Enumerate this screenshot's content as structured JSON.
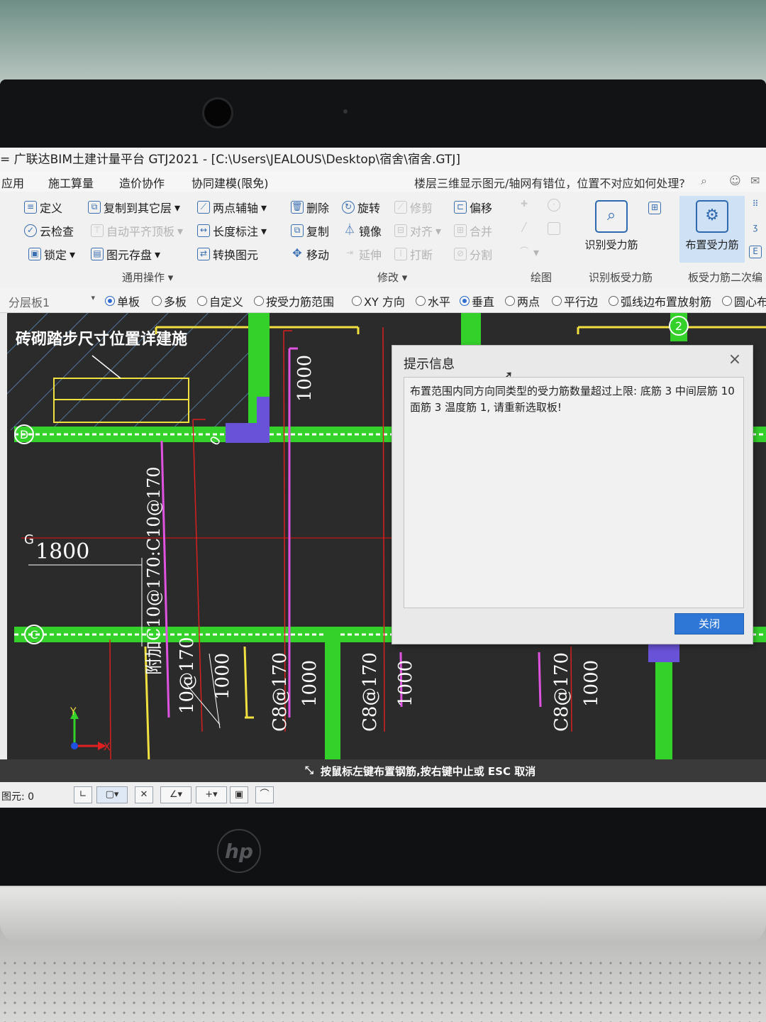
{
  "window": {
    "title": "= 广联达BIM土建计量平台 GTJ2021 - [C:\\Users\\JEALOUS\\Desktop\\宿舍\\宿舍.GTJ]"
  },
  "menu": {
    "items": [
      "应用",
      "施工算量",
      "造价协作",
      "协同建模(限免)"
    ],
    "question": "楼层三维显示图元/轴网有错位，位置不对应如何处理?"
  },
  "ribbon": {
    "general": [
      "定义",
      "复制到其它层",
      "两点辅轴",
      "云检查",
      "自动平齐顶板",
      "长度标注",
      "锁定",
      "图元存盘",
      "转换图元"
    ],
    "general_group": "通用操作",
    "modify": [
      "删除",
      "旋转",
      "修剪",
      "偏移",
      "复制",
      "镜像",
      "对齐",
      "合并",
      "移动",
      "延伸",
      "打断",
      "分割"
    ],
    "modify_group": "修改",
    "draw_group": "绘图",
    "identify_button": "识别受力筋",
    "identify_group": "识别板受力筋",
    "place_button": "布置受力筋",
    "place_group": "板受力筋二次编"
  },
  "options": {
    "layer": "分层板1",
    "radios": [
      {
        "label": "单板",
        "checked": true
      },
      {
        "label": "多板",
        "checked": false
      },
      {
        "label": "自定义",
        "checked": false
      },
      {
        "label": "按受力筋范围",
        "checked": false
      },
      {
        "label": "XY 方向",
        "checked": false
      },
      {
        "label": "水平",
        "checked": false
      },
      {
        "label": "垂直",
        "checked": true
      },
      {
        "label": "两点",
        "checked": false
      },
      {
        "label": "平行边",
        "checked": false
      },
      {
        "label": "弧线边布置放射筋",
        "checked": false
      },
      {
        "label": "圆心布",
        "checked": false
      }
    ]
  },
  "drawing": {
    "note": "砖砌踏步尺寸位置详建施",
    "axis_d": "D",
    "axis_c": "C",
    "axis_g": "G",
    "axis_2": "2",
    "dim_1800": "1800",
    "dim_1000": "1000",
    "small_0": "0",
    "rebar_vertical": "附加C10@170:C10@170",
    "labels": [
      "10@170",
      "1000",
      "C8@170",
      "1000",
      "C8@170",
      "1000",
      "C8@170",
      "1000"
    ],
    "axis_y": "Y",
    "axis_x": "X"
  },
  "dialog": {
    "title": "提示信息",
    "message": "布置范围内同方向同类型的受力筋数量超过上限: 底筋 3 中间层筋 10 面筋 3 温度筋 1, 请重新选取板!",
    "button": "关闭"
  },
  "status": {
    "hint": "按鼠标左键布置钢筋,按右键中止或 ESC 取消",
    "count_label": "图元: 0"
  },
  "device": {
    "logo": "hp"
  }
}
